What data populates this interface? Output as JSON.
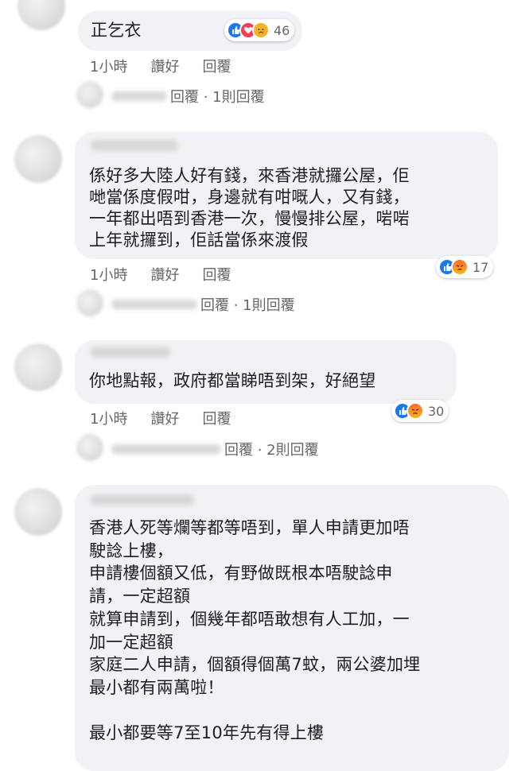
{
  "comments": [
    {
      "text": "正乞衣",
      "time": "1小時",
      "like": "讚好",
      "reply": "回覆",
      "reactions": [
        "like",
        "love",
        "sad"
      ],
      "reaction_count": "46",
      "reply_summary": "回覆 · 1則回覆"
    },
    {
      "text": "係好多大陸人好有錢，來香港就攞公屋，佢\n哋當係度假咁，身邊就有咁嘅人，又有錢，\n一年都出唔到香港一次，慢慢排公屋，啱啱\n上年就攞到，佢話當係來渡假",
      "time": "1小時",
      "like": "讚好",
      "reply": "回覆",
      "reactions": [
        "like",
        "angry"
      ],
      "reaction_count": "17",
      "reply_summary": "回覆 · 1則回覆"
    },
    {
      "text": "你地點報，政府都當睇唔到架，好絕望",
      "time": "1小時",
      "like": "讚好",
      "reply": "回覆",
      "reactions": [
        "like",
        "angry"
      ],
      "reaction_count": "30",
      "reply_summary": "回覆 · 2則回覆"
    },
    {
      "text": "香港人死等爛等都等唔到，單人申請更加唔\n駛諗上樓，\n申請樓個額又低，有野做既根本唔駛諗申\n請，一定超額\n就算申請到，個幾年都唔敢想有人工加，一\n加一定超額\n家庭二人申請，個額得個萬7蚊，兩公婆加埋\n最小都有兩萬啦！\n\n最小都要等7至10年先有得上樓"
    }
  ],
  "colors": {
    "bubble": "#f0f2f5",
    "meta_text": "#65676b",
    "like": "#1877f2",
    "love": "#f33e58"
  }
}
